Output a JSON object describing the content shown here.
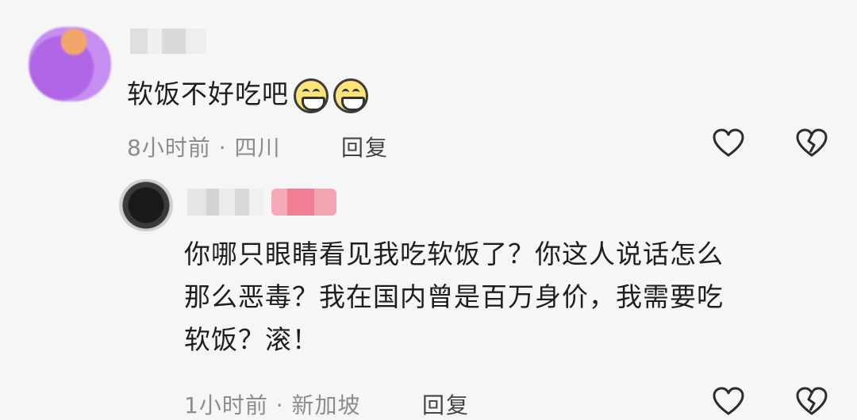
{
  "comment1": {
    "text": "软饭不好吃吧",
    "emojis": [
      "grinning-face-icon",
      "grinning-face-icon"
    ],
    "time": "8小时前 · 四川",
    "reply_label": "回复",
    "icons": [
      "heart-icon",
      "broken-heart-icon"
    ]
  },
  "reply1": {
    "lines": [
      "你哪只眼睛看见我吃软饭了？你这人说话怎么",
      "那么恶毒？我在国内曾是百万身价，我需要吃",
      "软饭？滚！"
    ],
    "time": "1小时前 · 新加坡",
    "reply_label": "回复",
    "icons": [
      "heart-icon",
      "broken-heart-icon"
    ]
  },
  "colors": {
    "background": "#f6f6f6",
    "text": "#1e1e1e",
    "meta": "#8c8c8c"
  }
}
